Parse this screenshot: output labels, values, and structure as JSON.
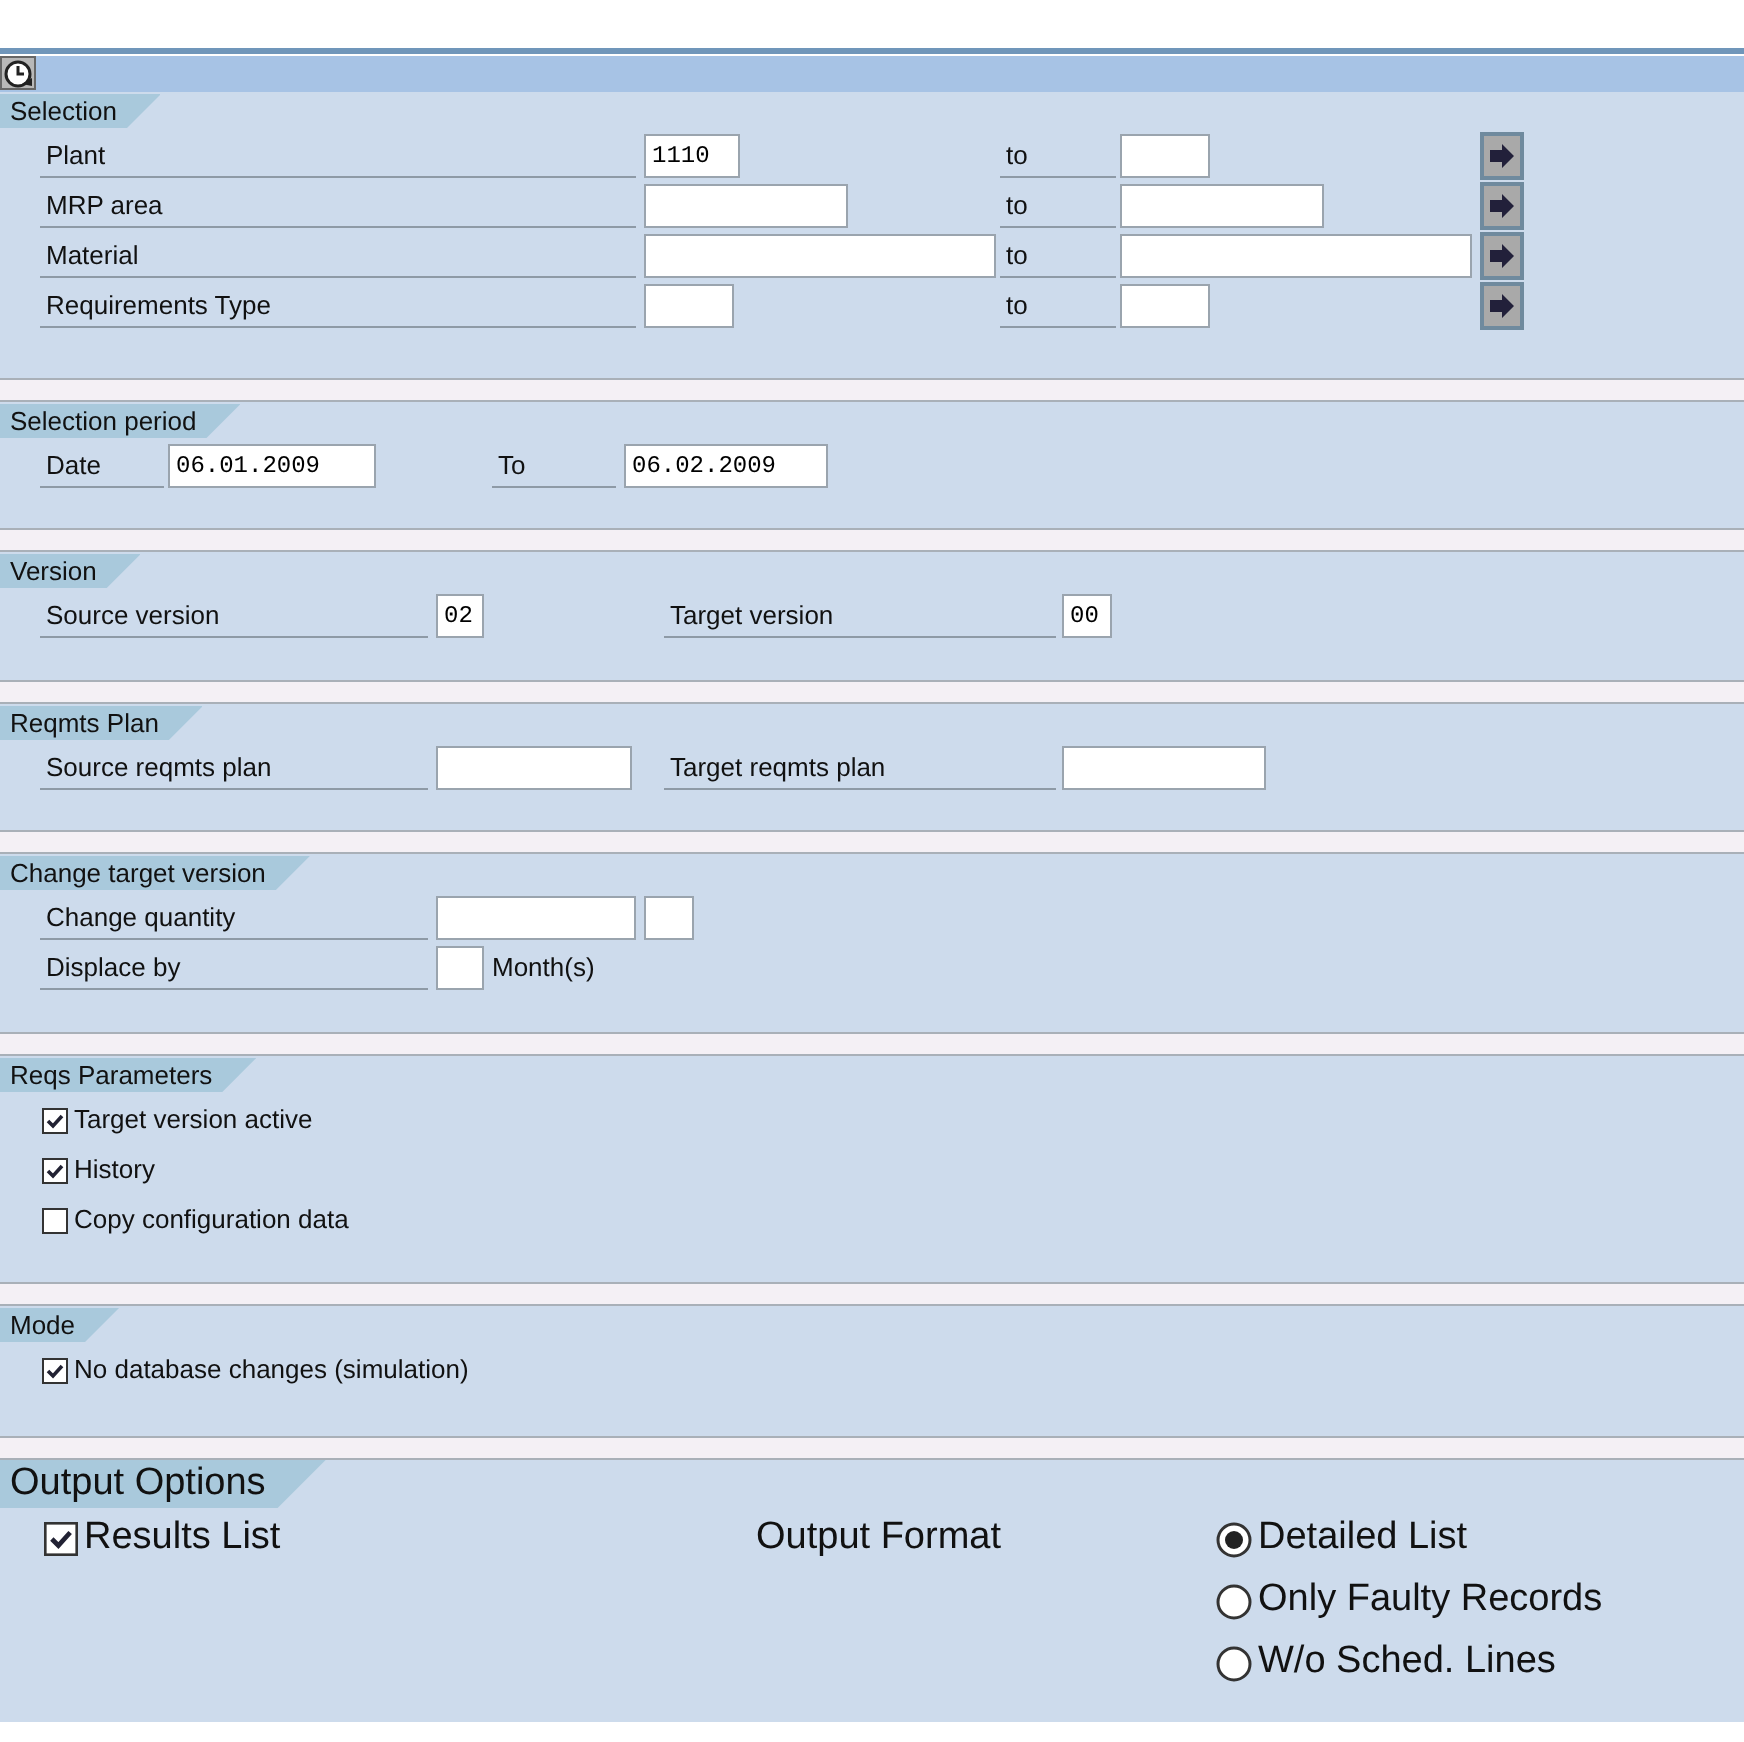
{
  "sections": [
    {
      "title": "Selection",
      "rows": [
        {
          "items": [
            {
              "kind": "label",
              "text": "Plant"
            },
            {
              "kind": "field",
              "value": "1110"
            },
            {
              "kind": "label",
              "text": "to"
            },
            {
              "kind": "field"
            },
            {
              "kind": "arrow"
            }
          ]
        },
        {
          "items": [
            {
              "kind": "label",
              "text": "MRP area"
            },
            {
              "kind": "field"
            },
            {
              "kind": "label",
              "text": "to"
            },
            {
              "kind": "field"
            },
            {
              "kind": "arrow"
            }
          ]
        },
        {
          "items": [
            {
              "kind": "label",
              "text": "Material"
            },
            {
              "kind": "field"
            },
            {
              "kind": "label",
              "text": "to"
            },
            {
              "kind": "field"
            },
            {
              "kind": "arrow"
            }
          ]
        },
        {
          "items": [
            {
              "kind": "label",
              "text": "Requirements Type"
            },
            {
              "kind": "field"
            },
            {
              "kind": "label",
              "text": "to"
            },
            {
              "kind": "field"
            },
            {
              "kind": "arrow"
            }
          ]
        }
      ]
    },
    {
      "title": "Selection period",
      "rows": [
        {
          "items": [
            {
              "kind": "label",
              "text": "Date"
            },
            {
              "kind": "field",
              "value": "06.01.2009"
            },
            {
              "kind": "label",
              "text": "To"
            },
            {
              "kind": "field",
              "value": "06.02.2009"
            }
          ]
        }
      ]
    },
    {
      "title": "Version",
      "rows": [
        {
          "items": [
            {
              "kind": "label",
              "text": "Source version"
            },
            {
              "kind": "field",
              "value": "02"
            },
            {
              "kind": "label",
              "text": "Target version"
            },
            {
              "kind": "field",
              "value": "00"
            }
          ]
        }
      ]
    },
    {
      "title": "Reqmts Plan",
      "rows": [
        {
          "items": [
            {
              "kind": "label",
              "text": "Source reqmts plan"
            },
            {
              "kind": "field"
            },
            {
              "kind": "label",
              "text": "Target reqmts plan"
            },
            {
              "kind": "field"
            }
          ]
        }
      ]
    },
    {
      "title": "Change target version",
      "rows": [
        {
          "items": [
            {
              "kind": "label",
              "text": "Change quantity"
            },
            {
              "kind": "field"
            },
            {
              "kind": "field"
            }
          ]
        },
        {
          "items": [
            {
              "kind": "label",
              "text": "Displace by"
            },
            {
              "kind": "field"
            },
            {
              "kind": "text",
              "text": "Month(s)"
            }
          ]
        }
      ]
    },
    {
      "title": "Reqs Parameters",
      "rows": [
        {
          "items": [
            {
              "kind": "checkbox",
              "label": "Target version active",
              "checked": true
            }
          ]
        },
        {
          "items": [
            {
              "kind": "checkbox",
              "label": "History",
              "checked": true
            }
          ]
        },
        {
          "items": [
            {
              "kind": "checkbox",
              "label": "Copy configuration data",
              "checked": false
            }
          ]
        }
      ]
    },
    {
      "title": "Mode",
      "rows": [
        {
          "items": [
            {
              "kind": "checkbox",
              "label": "No database changes (simulation)",
              "checked": true
            }
          ]
        }
      ]
    },
    {
      "title": "Output Options",
      "large": true,
      "rows": [
        {
          "items": [
            {
              "kind": "checkbox",
              "label": "Results List",
              "checked": true
            },
            {
              "kind": "text",
              "text": "Output Format"
            },
            {
              "kind": "radio",
              "label": "Detailed List",
              "selected": true
            }
          ]
        },
        {
          "items": [
            {
              "kind": "radio",
              "label": "Only Faulty Records",
              "selected": false
            }
          ]
        },
        {
          "items": [
            {
              "kind": "radio",
              "label": "W/o Sched. Lines",
              "selected": false
            }
          ]
        }
      ]
    }
  ]
}
